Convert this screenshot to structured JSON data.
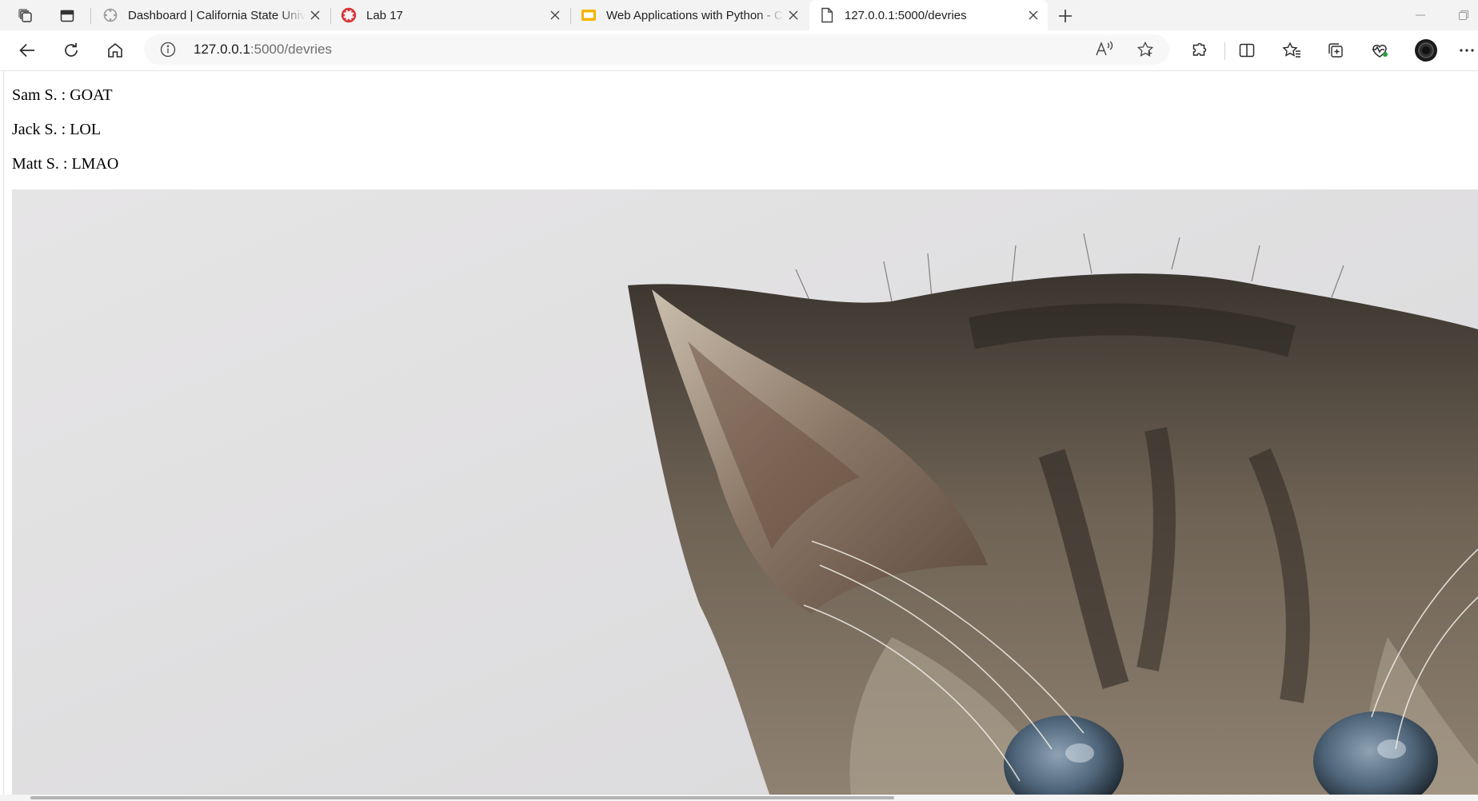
{
  "tabs": [
    {
      "title": "Dashboard | California State Univ",
      "favicon": "canvas-icon",
      "active": false
    },
    {
      "title": "Lab 17",
      "favicon": "canvas-red-icon",
      "active": false
    },
    {
      "title": "Web Applications with Python - C",
      "favicon": "slides-icon",
      "active": false
    },
    {
      "title": "127.0.0.1:5000/devries",
      "favicon": "page-icon",
      "active": true
    }
  ],
  "address_bar": {
    "host": "127.0.0.1",
    "path": ":5000/devries"
  },
  "toolbar_icons": [
    "back-icon",
    "refresh-icon",
    "home-icon",
    "info-icon",
    "read-aloud-icon",
    "favorite-star-icon",
    "extensions-icon",
    "split-screen-icon",
    "favorites-icon",
    "collections-icon",
    "browser-essentials-icon",
    "profile-icon",
    "more-icon"
  ],
  "page": {
    "entries": [
      {
        "text": "Sam S. : GOAT"
      },
      {
        "text": "Jack S. : LOL"
      },
      {
        "text": "Matt S. : LMAO"
      }
    ]
  },
  "colors": {
    "tab_strip": "#f3f3f3",
    "address_bar": "#f7f7f7",
    "canvas_red": "#d8363a",
    "slides_yellow": "#f5b400"
  }
}
